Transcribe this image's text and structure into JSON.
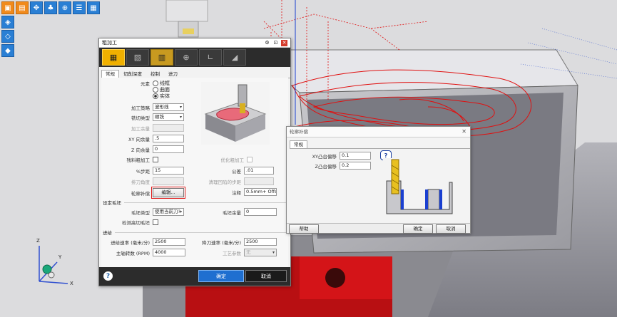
{
  "main_dialog": {
    "title": "粗加工",
    "tabs": [
      "常规",
      "切削深度",
      "控制",
      "进刀"
    ],
    "fields": {
      "element_label": "元素",
      "element_options": [
        "线框",
        "曲面",
        "实体"
      ],
      "strategy_label": "加工策略",
      "strategy_value": "波形线",
      "cut_type_label": "铣切类型",
      "cut_type_value": "顺铣",
      "machining_allow_label": "加工余量",
      "xy_stock_label": "XY 向余量",
      "xy_stock_value": ".5",
      "z_stock_label": "Z 向余量",
      "z_stock_value": "0",
      "residual_label": "残料粗加工",
      "optimize_label": "优化粗加工",
      "stepover_label": "%步距",
      "stepover_value": "15",
      "tolerance_label": "公差",
      "tolerance_value": ".01",
      "slot_angle_label": "排刀角度",
      "cleanup_label": "清理凹陷的步距",
      "comp_label": "轮廓补偿",
      "comp_button": "编辑...",
      "note_label": "注释",
      "note_value": "0.5mm+ Offse"
    },
    "stock_section": {
      "title": "设定毛坯",
      "type_label": "毛坯类型",
      "type_value": "使用当前刀?",
      "stock_allow_label": "毛坯余量",
      "stock_allow_value": "0",
      "check_label": "检测高切毛坯"
    },
    "feed_section": {
      "title": "进给",
      "feed_label": "进给速率 (毫米/分)",
      "feed_value": "2500",
      "plunge_label": "降刀速率 (毫米/分)",
      "plunge_value": "2500",
      "spindle_label": "主轴转数 (RPM)",
      "spindle_value": "4000",
      "tech_label": "工艺参数",
      "tech_value": "无"
    },
    "ok": "确定",
    "cancel": "取消"
  },
  "comp_dialog": {
    "title": "轮廓补偿",
    "tab": "常规",
    "xy_label": "XY凸台偏移",
    "xy_value": "0.1",
    "z_label": "Z凸台偏移",
    "z_value": "0.2",
    "help": "帮助",
    "ok": "确定",
    "cancel": "取消"
  },
  "axis": {
    "x": "X",
    "y": "Y",
    "z": "Z"
  }
}
